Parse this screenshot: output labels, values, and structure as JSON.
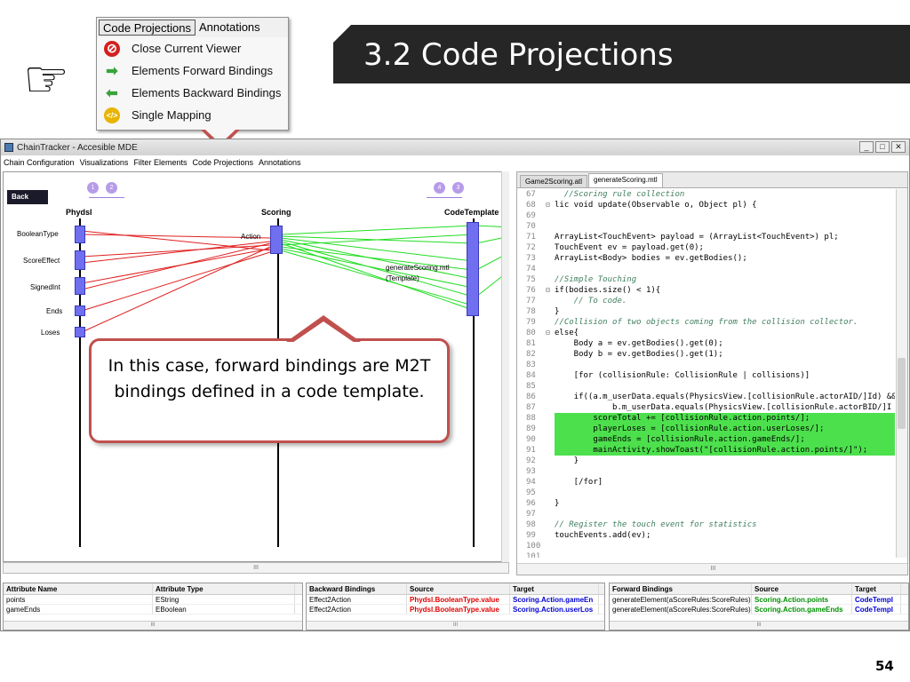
{
  "slide": {
    "title": "3.2 Code Projections",
    "page_number": "54"
  },
  "hand_icon": "pointing-hand-icon",
  "menu": {
    "tabs": [
      "Code Projections",
      "Annotations"
    ],
    "items": [
      {
        "label": "Close Current Viewer",
        "icon": "close-circle-icon",
        "color": "#d32020"
      },
      {
        "label": "Elements Forward Bindings",
        "icon": "arrow-right-icon",
        "color": "#3aa33a"
      },
      {
        "label": "Elements Backward Bindings",
        "icon": "arrow-left-icon",
        "color": "#3aa33a"
      },
      {
        "label": "Single Mapping",
        "icon": "code-mapping-icon",
        "color": "#e8b400"
      }
    ]
  },
  "app": {
    "title": "ChainTracker - Accesible MDE",
    "menubar": [
      "Chain Configuration",
      "Visualizations",
      "Filter Elements",
      "Code Projections",
      "Annotations"
    ],
    "viz": {
      "back_label": "Back",
      "left_circles": [
        "1",
        "2"
      ],
      "right_circles": [
        "4",
        "3"
      ],
      "columns": {
        "physdsl": "Phydsl",
        "scoring": "Scoring",
        "codetemplate": "CodeTemplate"
      },
      "attributes": [
        "BooleanType",
        "ScoreEffect",
        "SignedInt",
        "Ends",
        "Loses"
      ],
      "action_label": "Action",
      "template_label_1": "generateScoring.mtl",
      "template_label_2": "(Template)",
      "scroll_mark": "III"
    },
    "editor": {
      "tabs": [
        "Game2Scoring.atl",
        "generateScoring.mtl"
      ],
      "scroll_mark": "III",
      "lines": [
        {
          "n": "67",
          "m": "",
          "t": "  //Scoring rule collection",
          "hl": false
        },
        {
          "n": "68",
          "m": "⊟",
          "t": "lic void update(Observable o, Object pl) {",
          "hl": false
        },
        {
          "n": "69",
          "m": "",
          "t": "",
          "hl": false
        },
        {
          "n": "70",
          "m": "",
          "t": "",
          "hl": false
        },
        {
          "n": "71",
          "m": "",
          "t": "ArrayList<TouchEvent> payload = (ArrayList<TouchEvent>) pl;",
          "hl": false
        },
        {
          "n": "72",
          "m": "",
          "t": "TouchEvent ev = payload.get(0);",
          "hl": false
        },
        {
          "n": "73",
          "m": "",
          "t": "ArrayList<Body> bodies = ev.getBodies();",
          "hl": false
        },
        {
          "n": "74",
          "m": "",
          "t": "",
          "hl": false
        },
        {
          "n": "75",
          "m": "",
          "t": "//Simple Touching",
          "hl": false
        },
        {
          "n": "76",
          "m": "⊟",
          "t": "if(bodies.size() < 1){",
          "hl": false
        },
        {
          "n": "77",
          "m": "",
          "t": "    // To code.",
          "hl": false
        },
        {
          "n": "78",
          "m": "",
          "t": "}",
          "hl": false
        },
        {
          "n": "79",
          "m": "",
          "t": "//Collision of two objects coming from the collision collector.",
          "hl": false
        },
        {
          "n": "80",
          "m": "⊟",
          "t": "else{",
          "hl": false
        },
        {
          "n": "81",
          "m": "",
          "t": "    Body a = ev.getBodies().get(0);",
          "hl": false
        },
        {
          "n": "82",
          "m": "",
          "t": "    Body b = ev.getBodies().get(1);",
          "hl": false
        },
        {
          "n": "83",
          "m": "",
          "t": "",
          "hl": false
        },
        {
          "n": "84",
          "m": "",
          "t": "    [for (collisionRule: CollisionRule | collisions)]",
          "hl": false
        },
        {
          "n": "85",
          "m": "",
          "t": "",
          "hl": false
        },
        {
          "n": "86",
          "m": "",
          "t": "    if((a.m_userData.equals(PhysicsView.[collisionRule.actorAID/]Id) &&",
          "hl": false
        },
        {
          "n": "87",
          "m": "",
          "t": "            b.m_userData.equals(PhysicsView.[collisionRule.actorBID/]I",
          "hl": false
        },
        {
          "n": "88",
          "m": "",
          "t": "        scoreTotal += [collisionRule.action.points/];",
          "hl": true
        },
        {
          "n": "89",
          "m": "",
          "t": "        playerLoses = [collisionRule.action.userLoses/];",
          "hl": true
        },
        {
          "n": "90",
          "m": "",
          "t": "        gameEnds = [collisionRule.action.gameEnds/];",
          "hl": true
        },
        {
          "n": "91",
          "m": "",
          "t": "        mainActivity.showToast(\"[collisionRule.action.points/]\");",
          "hl": true
        },
        {
          "n": "92",
          "m": "",
          "t": "    }",
          "hl": false
        },
        {
          "n": "93",
          "m": "",
          "t": "",
          "hl": false
        },
        {
          "n": "94",
          "m": "",
          "t": "    [/for]",
          "hl": false
        },
        {
          "n": "95",
          "m": "",
          "t": "",
          "hl": false
        },
        {
          "n": "96",
          "m": "",
          "t": "}",
          "hl": false
        },
        {
          "n": "97",
          "m": "",
          "t": "",
          "hl": false
        },
        {
          "n": "98",
          "m": "",
          "t": "// Register the touch event for statistics",
          "hl": false
        },
        {
          "n": "99",
          "m": "",
          "t": "touchEvents.add(ev);",
          "hl": false
        },
        {
          "n": "100",
          "m": "",
          "t": "",
          "hl": false
        },
        {
          "n": "101",
          "m": "",
          "t": "",
          "hl": false
        }
      ]
    },
    "attr_panel": {
      "headers": [
        "Attribute Name",
        "Attribute Type"
      ],
      "rows": [
        [
          "points",
          "EString"
        ],
        [
          "gameEnds",
          "EBoolean"
        ]
      ],
      "scroll_mark": "III"
    },
    "back_panel": {
      "headers": [
        "Backward Bindings",
        "Source",
        "Target"
      ],
      "rows": [
        [
          "Effect2Action",
          "Phydsl.BooleanType.value",
          "Scoring.Action.gameEn"
        ],
        [
          "Effect2Action",
          "Phydsl.BooleanType.value",
          "Scoring.Action.userLos"
        ]
      ],
      "scroll_mark": "III"
    },
    "fwd_panel": {
      "headers": [
        "Forward Bindings",
        "Source",
        "Target"
      ],
      "rows": [
        [
          "generateElement(aScoreRules:ScoreRules)",
          "Scoring.Action.points",
          "CodeTempl"
        ],
        [
          "generateElement(aScoreRules:ScoreRules)",
          "Scoring.Action.gameEnds",
          "CodeTempl"
        ]
      ],
      "scroll_mark": "III"
    }
  },
  "callout": {
    "text": "In this case, forward bindings are M2T bindings defined in a code template."
  },
  "colors": {
    "highlight": "#4de04d",
    "red_binding": "#e02020",
    "green_binding": "#22dd22",
    "callout_border": "#c0504d",
    "title_bg": "#262626"
  }
}
